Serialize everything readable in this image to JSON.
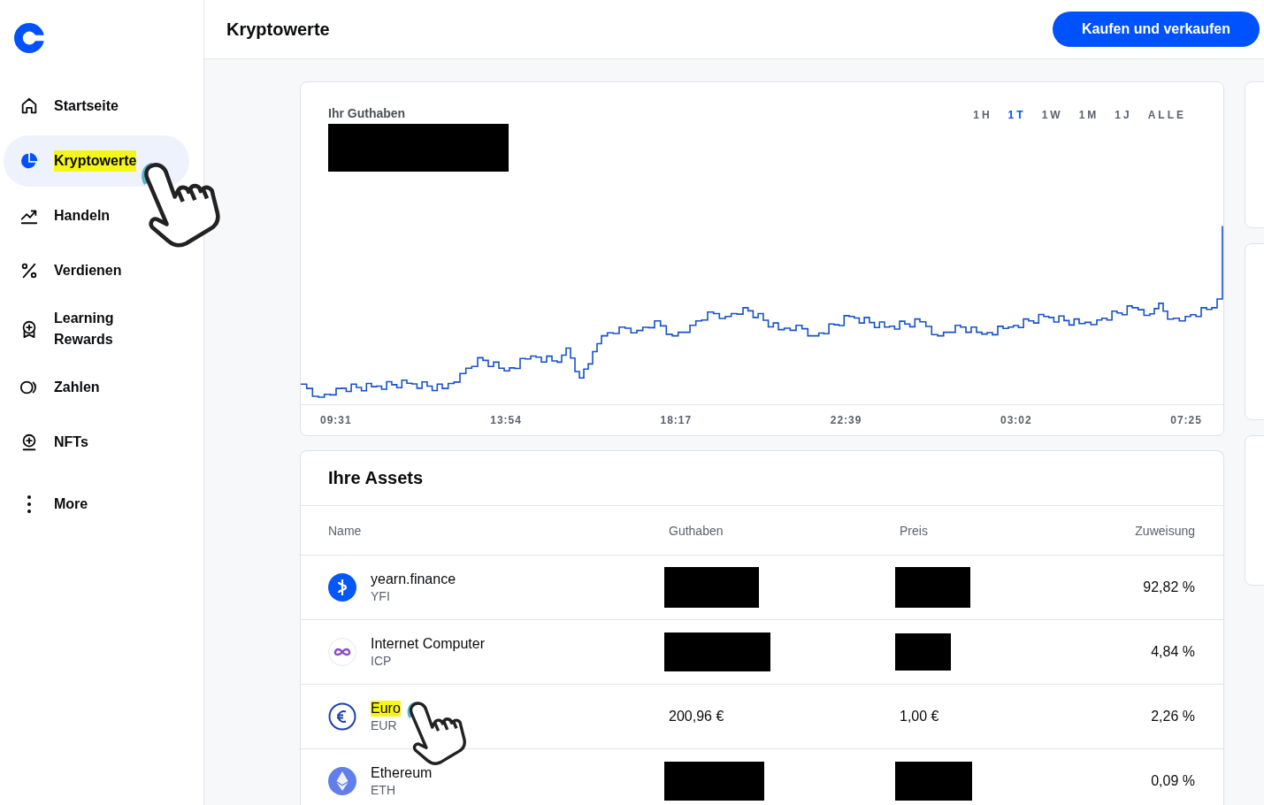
{
  "sidebar": {
    "items": [
      {
        "label": "Startseite",
        "selected": false,
        "highlighted": false,
        "pointer": false
      },
      {
        "label": "Kryptowerte",
        "selected": true,
        "highlighted": true,
        "pointer": true
      },
      {
        "label": "Handeln",
        "selected": false,
        "highlighted": false,
        "pointer": false
      },
      {
        "label": "Verdienen",
        "selected": false,
        "highlighted": false,
        "pointer": false
      },
      {
        "label": "Learning Rewards",
        "selected": false,
        "highlighted": false,
        "pointer": false
      },
      {
        "label": "Zahlen",
        "selected": false,
        "highlighted": false,
        "pointer": false
      },
      {
        "label": "NFTs",
        "selected": false,
        "highlighted": false,
        "pointer": false
      },
      {
        "label": "More",
        "selected": false,
        "highlighted": false,
        "pointer": false
      }
    ]
  },
  "header": {
    "title": "Kryptowerte",
    "button": "Kaufen und verkaufen"
  },
  "balance": {
    "label": "Ihr Guthaben",
    "redacted": true,
    "periods": [
      {
        "label": "1H",
        "selected": false
      },
      {
        "label": "1T",
        "selected": true
      },
      {
        "label": "1W",
        "selected": false
      },
      {
        "label": "1M",
        "selected": false
      },
      {
        "label": "1J",
        "selected": false
      },
      {
        "label": "ALLE",
        "selected": false
      }
    ],
    "time_labels": [
      "09:31",
      "13:54",
      "18:17",
      "22:39",
      "03:02",
      "07:25"
    ]
  },
  "assets": {
    "title": "Ihre Assets",
    "columns": [
      "Name",
      "Guthaben",
      "Preis",
      "Zuweisung"
    ],
    "rows": [
      {
        "name": "yearn.finance",
        "symbol": "YFI",
        "highlighted": false,
        "pointer": false,
        "balance": {
          "redacted": true
        },
        "price": {
          "redacted": true
        },
        "allocation": "92,82 %"
      },
      {
        "name": "Internet Computer",
        "symbol": "ICP",
        "highlighted": false,
        "pointer": false,
        "balance": {
          "redacted": true
        },
        "price": {
          "redacted": true
        },
        "allocation": "4,84 %"
      },
      {
        "name": "Euro",
        "symbol": "EUR",
        "highlighted": true,
        "pointer": true,
        "balance": {
          "redacted": false,
          "text": "200,96 €"
        },
        "price": {
          "redacted": false,
          "text": "1,00 €"
        },
        "allocation": "2,26 %"
      },
      {
        "name": "Ethereum",
        "symbol": "ETH",
        "highlighted": false,
        "pointer": false,
        "balance": {
          "redacted": true
        },
        "price": {
          "redacted": true
        },
        "allocation": "0,09 %"
      }
    ]
  }
}
